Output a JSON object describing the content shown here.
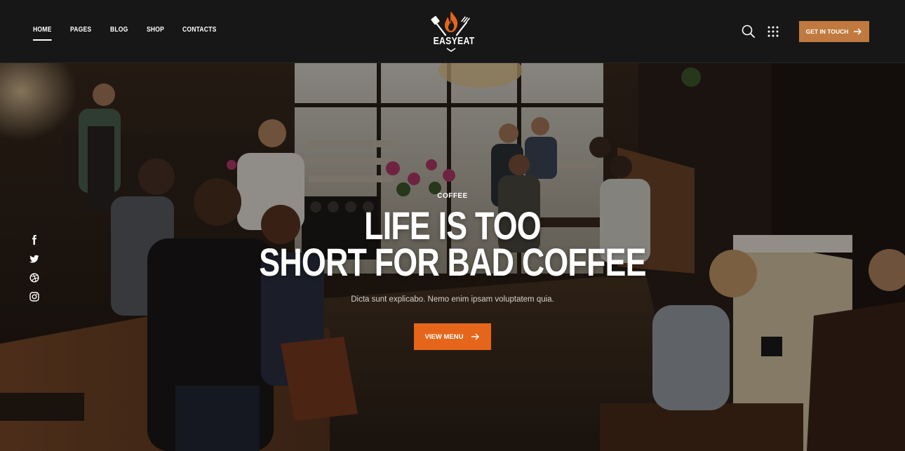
{
  "colors": {
    "header_bg": "#171717",
    "accent_orange": "#e5661a",
    "accent_copper": "#c07a3f",
    "text": "#ffffff"
  },
  "header": {
    "nav": [
      {
        "label": "HOME",
        "active": true
      },
      {
        "label": "PAGES",
        "active": false
      },
      {
        "label": "BLOG",
        "active": false
      },
      {
        "label": "SHOP",
        "active": false
      },
      {
        "label": "CONTACTS",
        "active": false
      }
    ],
    "logo_text": "EASYEAT",
    "logo_icon": "flame-with-utensils-icon",
    "search_icon": "search-icon",
    "menu_icon": "grid-dots-icon",
    "cta_label": "GET IN TOUCH",
    "cta_icon": "arrow-right-icon"
  },
  "social": [
    "facebook-icon",
    "twitter-icon",
    "dribbble-icon",
    "instagram-icon"
  ],
  "hero": {
    "eyebrow": "COFFEE",
    "headline_line1": "LIFE IS TOO",
    "headline_line2": "SHORT FOR BAD COFFEE",
    "subtext": "Dicta sunt explicabo. Nemo enim ipsam voluptatem quia.",
    "button_label": "VIEW MENU",
    "button_icon": "arrow-right-icon",
    "background": "coffee-shop-interior-photo"
  }
}
